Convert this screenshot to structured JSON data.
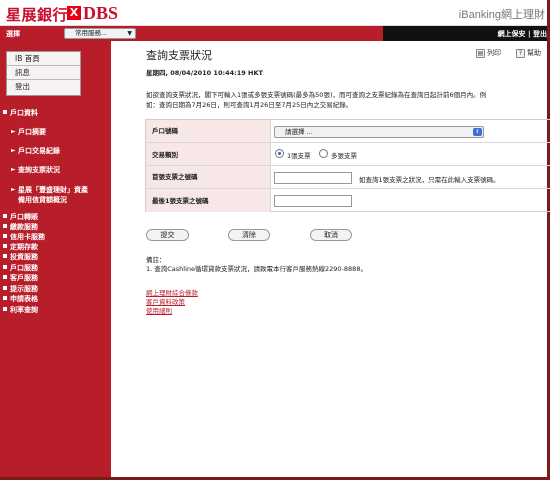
{
  "header": {
    "logo_cn": "星展銀行",
    "logo_x": "X",
    "logo_en": "DBS",
    "brand_right": "iBanking網上理財",
    "select_label": "選擇",
    "services_select": "常用服務...",
    "top_links": "網上保安 | 登出"
  },
  "sidebar": {
    "ib_items": [
      "IB 首頁",
      "訊息",
      "登出"
    ],
    "account_section": "戶口資料",
    "account_sub": [
      "戶口摘要",
      "戶口交易紀錄",
      "查詢支票狀況"
    ],
    "treasure_line1": "星展「豐盛理財」資產",
    "treasure_line2": "備用信貸額概況",
    "sections": [
      "戶口轉賬",
      "繳款服務",
      "信用卡服務",
      "定期存款",
      "投資服務",
      "戶口服務",
      "客戶服務",
      "提示服務",
      "申請表格",
      "利率查詢"
    ]
  },
  "main": {
    "title": "查詢支票狀況",
    "print": "列印",
    "help": "幫助",
    "datetime": "星期四, 08/04/2010 10:44:19 HKT",
    "intro_line1": "如欲查詢支票狀況，閣下可輸入1張或多張支票號碼(最多為50張)，而可查詢之支票紀錄為在查詢日起計前6個月內。例",
    "intro_line2": "如：查詢日期為7月26日，則可查詢1月26日至7月25日內之交易紀錄。"
  },
  "form": {
    "account_label": "戶口號碼",
    "account_value": "請選擇 ...",
    "type_label": "交易類別",
    "type_option1": "1張支票",
    "type_option2": "多張支票",
    "first_label": "首張支票之號碼",
    "hint": "如查詢1張支票之狀況，只需在此輸入支票號碼。",
    "last_label": "最後1張支票之號碼"
  },
  "buttons": {
    "submit": "提交",
    "clear": "清除",
    "cancel": "取消"
  },
  "notes": {
    "title": "備註：",
    "item1": "1.    查詢Cashline循環貸款支票狀況，請致電本行客戶服務熱線2290-8888。"
  },
  "links": [
    "網上理財綜合條款",
    "客戶資料政策",
    "使用細則"
  ]
}
